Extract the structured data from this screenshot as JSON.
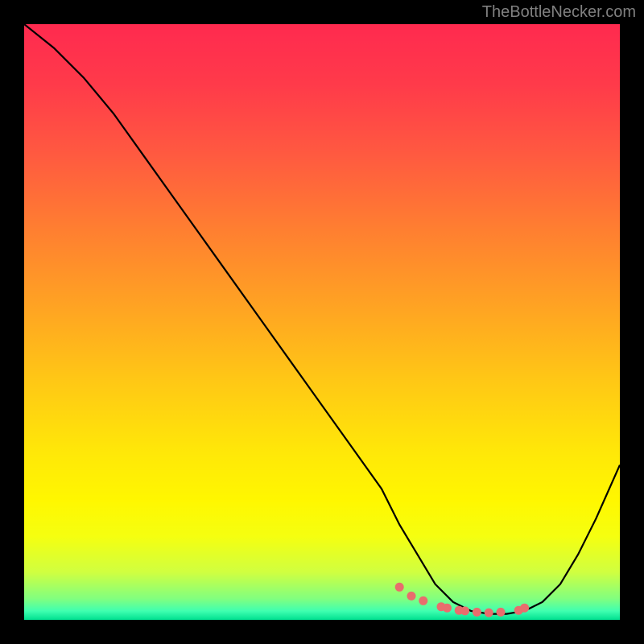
{
  "watermark": "TheBottleNecker.com",
  "chart_data": {
    "type": "line",
    "title": "",
    "xlabel": "",
    "ylabel": "",
    "xlim": [
      0,
      100
    ],
    "ylim": [
      0,
      100
    ],
    "series": [
      {
        "name": "bottleneck-curve",
        "x": [
          0,
          5,
          10,
          15,
          20,
          25,
          30,
          35,
          40,
          45,
          50,
          55,
          60,
          63,
          66,
          69,
          72,
          75,
          78,
          81,
          84,
          87,
          90,
          93,
          96,
          100
        ],
        "values": [
          100,
          96,
          91,
          85,
          78,
          71,
          64,
          57,
          50,
          43,
          36,
          29,
          22,
          16,
          11,
          6,
          3,
          1.5,
          1,
          1,
          1.5,
          3,
          6,
          11,
          17,
          26
        ]
      }
    ],
    "highlight_dots": {
      "name": "sweet-spot",
      "x": [
        63,
        65,
        67,
        70,
        71,
        73,
        74,
        76,
        78,
        80,
        83,
        84
      ],
      "values": [
        5.5,
        4.0,
        3.2,
        2.2,
        2.0,
        1.6,
        1.5,
        1.3,
        1.2,
        1.3,
        1.6,
        2.0
      ]
    },
    "colors": {
      "curve": "#000000",
      "dots": "#e86d6d",
      "gradient_top": "#ff2a4f",
      "gradient_bottom": "#00e090"
    }
  }
}
